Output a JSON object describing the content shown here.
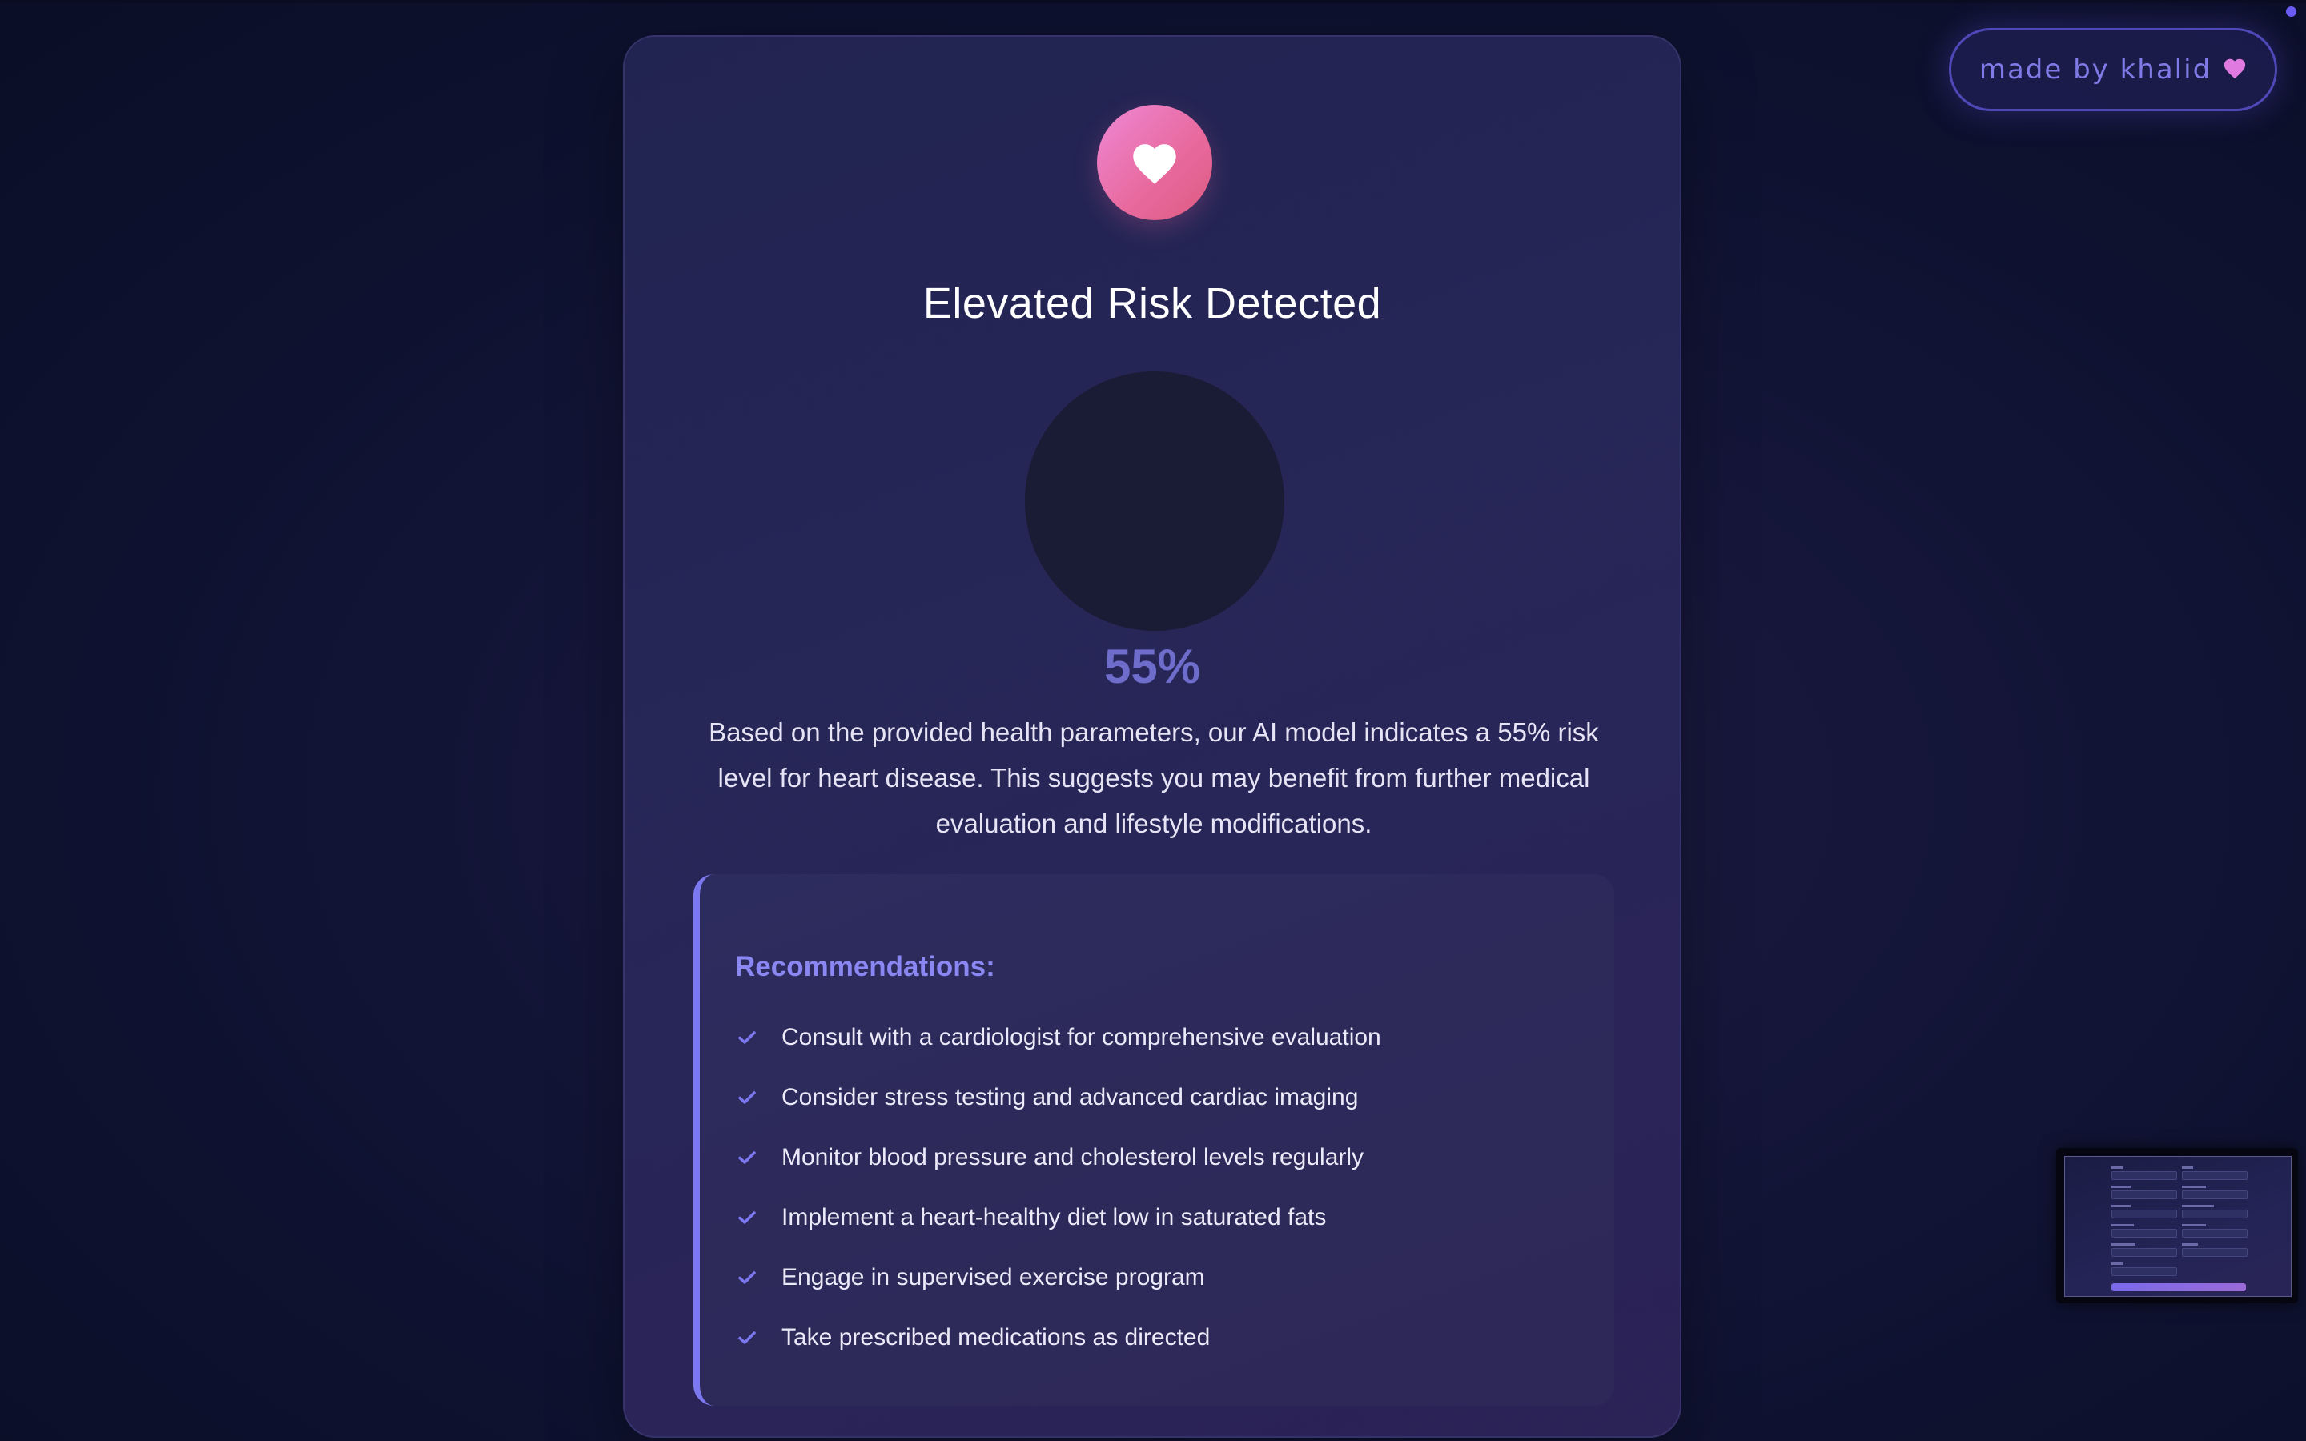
{
  "result": {
    "title": "Elevated Risk Detected",
    "risk_percent": "55%",
    "description": "Based on the provided health parameters, our AI model indicates a 55% risk level for heart disease. This suggests you may benefit from further medical evaluation and lifestyle modifications."
  },
  "recommendations": {
    "title": "Recommendations:",
    "items": [
      "Consult with a cardiologist for comprehensive evaluation",
      "Consider stress testing and advanced cardiac imaging",
      "Monitor blood pressure and cholesterol levels regularly",
      "Implement a heart-healthy diet low in saturated fats",
      "Engage in supervised exercise program",
      "Take prescribed medications as directed"
    ]
  },
  "badge": {
    "label": "made by khalid"
  },
  "icons": {
    "header": "heart-icon",
    "badge": "heart-icon",
    "list": "check-icon"
  },
  "colors": {
    "accent": "#7c78f0",
    "percent": "#6f6dcc",
    "heart_gradient_start": "#ee88d6",
    "heart_gradient_end": "#de5a80",
    "badge_heart": "#e07ae0"
  }
}
